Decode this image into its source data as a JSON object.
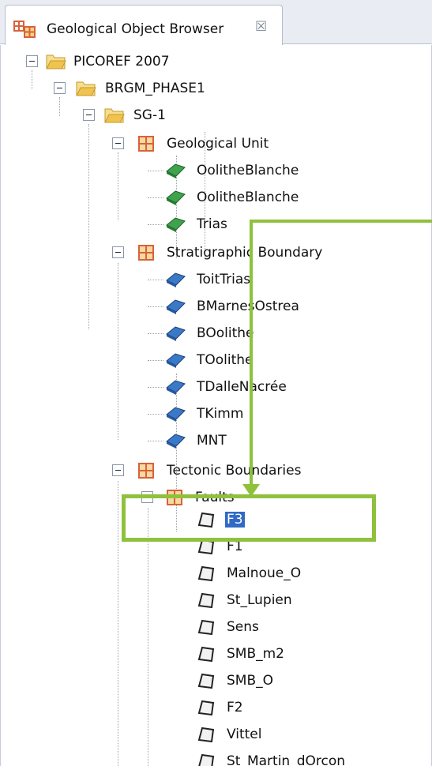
{
  "tab": {
    "label": "Geological Object Browser",
    "close": "☒",
    "icon": "geo-browser-icon"
  },
  "colors": {
    "selection": "#316ac5",
    "annotation": "#8fc13c",
    "unit_icon": "#3fa34d",
    "boundary_icon": "#3a78c8",
    "folder_icon": "#f0c24e",
    "group_icon": "#d8623a"
  },
  "tree": {
    "root": "PICOREF 2007",
    "project": "BRGM_PHASE1",
    "study": "SG-1",
    "geological_unit": {
      "label": "Geological Unit",
      "items": [
        "OolitheBlanche",
        "OolitheBlanche",
        "Trias"
      ]
    },
    "strat_boundary": {
      "label": "Stratigraphic Boundary",
      "items": [
        "ToitTrias",
        "BMarnesOstrea",
        "BOolithe",
        "TOolithe",
        "TDalleNacrée",
        "TKimm",
        "MNT"
      ]
    },
    "tectonic": {
      "label": "Tectonic Boundaries",
      "faults": {
        "label": "Faults",
        "selected": "F3",
        "items": [
          "F1",
          "Malnoue_O",
          "St_Lupien",
          "Sens",
          "SMB_m2",
          "SMB_O",
          "F2",
          "Vittel",
          "St_Martin_dOrcon"
        ]
      }
    }
  }
}
